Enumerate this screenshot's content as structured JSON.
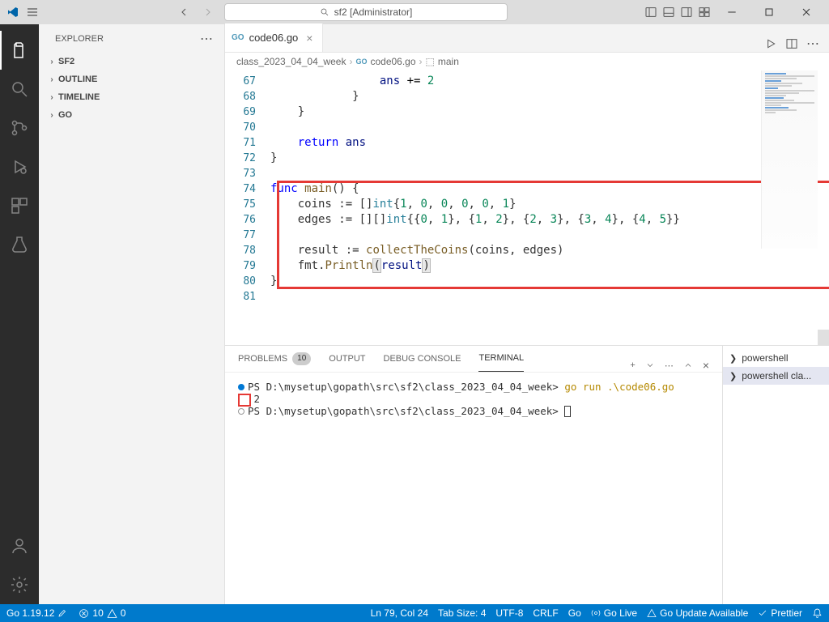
{
  "titlebar": {
    "search_text": "sf2 [Administrator]"
  },
  "sidebar": {
    "title": "EXPLORER",
    "items": [
      "SF2",
      "OUTLINE",
      "TIMELINE",
      "GO"
    ]
  },
  "tabs": {
    "file_icon": "GO",
    "file_name": "code06.go"
  },
  "breadcrumb": {
    "p1": "class_2023_04_04_week",
    "p2": "code06.go",
    "p3": "main"
  },
  "code": {
    "lines": [
      {
        "n": "67",
        "seg": [
          {
            "t": "                ",
            "c": ""
          },
          {
            "t": "ans",
            "c": "var"
          },
          {
            "t": " ",
            "c": ""
          },
          {
            "t": "+=",
            "c": "op"
          },
          {
            "t": " ",
            "c": ""
          },
          {
            "t": "2",
            "c": "num"
          }
        ]
      },
      {
        "n": "68",
        "seg": [
          {
            "t": "            }",
            "c": ""
          }
        ]
      },
      {
        "n": "69",
        "seg": [
          {
            "t": "    }",
            "c": ""
          }
        ]
      },
      {
        "n": "70",
        "seg": [
          {
            "t": "",
            "c": ""
          }
        ]
      },
      {
        "n": "71",
        "seg": [
          {
            "t": "    ",
            "c": ""
          },
          {
            "t": "return",
            "c": "kw"
          },
          {
            "t": " ",
            "c": ""
          },
          {
            "t": "ans",
            "c": "var"
          }
        ]
      },
      {
        "n": "72",
        "seg": [
          {
            "t": "}",
            "c": ""
          }
        ]
      },
      {
        "n": "73",
        "seg": [
          {
            "t": "",
            "c": ""
          }
        ]
      },
      {
        "n": "74",
        "seg": [
          {
            "t": "func",
            "c": "kw"
          },
          {
            "t": " ",
            "c": ""
          },
          {
            "t": "main",
            "c": "fn"
          },
          {
            "t": "() {",
            "c": ""
          }
        ]
      },
      {
        "n": "75",
        "seg": [
          {
            "t": "    coins := []",
            "c": ""
          },
          {
            "t": "int",
            "c": "typ"
          },
          {
            "t": "{",
            "c": ""
          },
          {
            "t": "1",
            "c": "num"
          },
          {
            "t": ", ",
            "c": ""
          },
          {
            "t": "0",
            "c": "num"
          },
          {
            "t": ", ",
            "c": ""
          },
          {
            "t": "0",
            "c": "num"
          },
          {
            "t": ", ",
            "c": ""
          },
          {
            "t": "0",
            "c": "num"
          },
          {
            "t": ", ",
            "c": ""
          },
          {
            "t": "0",
            "c": "num"
          },
          {
            "t": ", ",
            "c": ""
          },
          {
            "t": "1",
            "c": "num"
          },
          {
            "t": "}",
            "c": ""
          }
        ]
      },
      {
        "n": "76",
        "seg": [
          {
            "t": "    edges := [][]",
            "c": ""
          },
          {
            "t": "int",
            "c": "typ"
          },
          {
            "t": "{{",
            "c": ""
          },
          {
            "t": "0",
            "c": "num"
          },
          {
            "t": ", ",
            "c": ""
          },
          {
            "t": "1",
            "c": "num"
          },
          {
            "t": "}, {",
            "c": ""
          },
          {
            "t": "1",
            "c": "num"
          },
          {
            "t": ", ",
            "c": ""
          },
          {
            "t": "2",
            "c": "num"
          },
          {
            "t": "}, {",
            "c": ""
          },
          {
            "t": "2",
            "c": "num"
          },
          {
            "t": ", ",
            "c": ""
          },
          {
            "t": "3",
            "c": "num"
          },
          {
            "t": "}, {",
            "c": ""
          },
          {
            "t": "3",
            "c": "num"
          },
          {
            "t": ", ",
            "c": ""
          },
          {
            "t": "4",
            "c": "num"
          },
          {
            "t": "}, {",
            "c": ""
          },
          {
            "t": "4",
            "c": "num"
          },
          {
            "t": ", ",
            "c": ""
          },
          {
            "t": "5",
            "c": "num"
          },
          {
            "t": "}}",
            "c": ""
          }
        ]
      },
      {
        "n": "77",
        "seg": [
          {
            "t": "",
            "c": ""
          }
        ]
      },
      {
        "n": "78",
        "seg": [
          {
            "t": "    result := ",
            "c": ""
          },
          {
            "t": "collectTheCoins",
            "c": "fn"
          },
          {
            "t": "(coins, edges)",
            "c": ""
          }
        ]
      },
      {
        "n": "79",
        "seg": [
          {
            "t": "    fmt.",
            "c": ""
          },
          {
            "t": "Println",
            "c": "fn"
          },
          {
            "t": "(",
            "c": "matched-bracket"
          },
          {
            "t": "result",
            "c": "var"
          },
          {
            "t": ")",
            "c": "matched-bracket"
          }
        ]
      },
      {
        "n": "80",
        "seg": [
          {
            "t": "}",
            "c": ""
          }
        ]
      },
      {
        "n": "81",
        "seg": [
          {
            "t": "",
            "c": ""
          }
        ]
      }
    ]
  },
  "panel": {
    "tabs": {
      "problems": "PROBLEMS",
      "problems_count": "10",
      "output": "OUTPUT",
      "debug": "DEBUG CONSOLE",
      "terminal": "TERMINAL"
    },
    "term": {
      "prompt1": "PS D:\\mysetup\\gopath\\src\\sf2\\class_2023_04_04_week> ",
      "cmd": "go run .\\code06.go",
      "output": " 2",
      "prompt2": "PS D:\\mysetup\\gopath\\src\\sf2\\class_2023_04_04_week> "
    },
    "shells": [
      "powershell",
      "powershell  cla..."
    ]
  },
  "status": {
    "go_ver": "Go 1.19.12",
    "errors": "10",
    "warnings": "0",
    "ln_col": "Ln 79, Col 24",
    "tab": "Tab Size: 4",
    "enc": "UTF-8",
    "eol": "CRLF",
    "lang": "Go",
    "live": "Go Live",
    "update": "Go Update Available",
    "prettier": "Prettier"
  }
}
